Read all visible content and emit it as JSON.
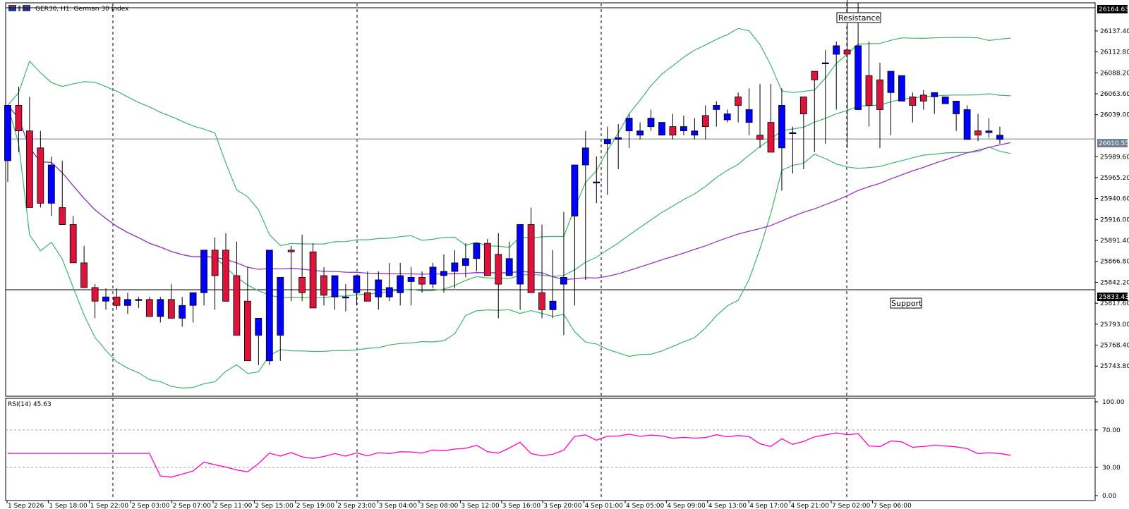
{
  "header": {
    "symbol_label": "GER30, H1:  German 30 Index"
  },
  "price_axis": {
    "ticks": [
      "26137.40",
      "26112.80",
      "26088.20",
      "26063.60",
      "26039.00",
      "25989.60",
      "25965.20",
      "25940.60",
      "25916.00",
      "25891.40",
      "25866.80",
      "25842.20",
      "25817.60",
      "25793.00",
      "25768.40",
      "25743.80"
    ],
    "tick_values": [
      26137.4,
      26112.8,
      26088.2,
      26063.6,
      26039.0,
      25989.6,
      25965.2,
      25940.6,
      25916.0,
      25891.4,
      25866.8,
      25842.2,
      25817.6,
      25793.0,
      25768.4,
      25743.8
    ],
    "resistance_label": "26164.63",
    "current_label": "26010.55",
    "support_label": "25833.43"
  },
  "levels": {
    "resistance": {
      "value": 26164.63,
      "tag": "Resistance"
    },
    "support": {
      "value": 25833.43,
      "tag": "Support"
    },
    "current": 26010.55
  },
  "rsi": {
    "label": "RSI(14) 45.63",
    "ticks": [
      "100.00",
      "70.00",
      "30.00",
      "0.00"
    ],
    "tick_values": [
      100,
      70,
      30,
      0
    ]
  },
  "time_axis": {
    "labels": [
      "1 Sep 2026",
      "1 Sep 18:00",
      "1 Sep 22:00",
      "2 Sep 03:00",
      "2 Sep 07:00",
      "2 Sep 11:00",
      "2 Sep 15:00",
      "2 Sep 19:00",
      "2 Sep 23:00",
      "3 Sep 04:00",
      "3 Sep 08:00",
      "3 Sep 12:00",
      "3 Sep 16:00",
      "3 Sep 20:00",
      "4 Sep 01:00",
      "4 Sep 05:00",
      "4 Sep 09:00",
      "4 Sep 13:00",
      "4 Sep 17:00",
      "4 Sep 21:00",
      "7 Sep 02:00",
      "7 Sep 06:00"
    ]
  },
  "colors": {
    "bull": "#0000ff",
    "bear": "#dc143c",
    "bands": "#3cb371",
    "ma": "#9932cc",
    "rsi": "#ff00c8"
  },
  "chart_data": {
    "type": "candlestick",
    "open": [
      25985,
      26050,
      26020,
      26000,
      25935,
      25930,
      25910,
      25865,
      25836,
      25820,
      25825,
      25815,
      25822,
      25822,
      25802,
      25822,
      25800,
      25815,
      25830,
      25880,
      25880,
      25850,
      25820,
      25780,
      25750,
      25780,
      25880,
      25848,
      25878,
      25850,
      25825,
      25825,
      25830,
      25830,
      25825,
      25825,
      25830,
      25843,
      25848,
      25840,
      25850,
      25855,
      25862,
      25870,
      25888,
      25875,
      25850,
      25840,
      25910,
      25830,
      25810,
      25840,
      25920,
      25980,
      25960,
      26005,
      26010,
      26020,
      26015,
      26025,
      26015,
      26025,
      26020,
      26015,
      26038,
      26045,
      26033,
      26060,
      26030,
      26015,
      26030,
      26000,
      26018,
      26060,
      26090,
      26100,
      26110,
      26115,
      26045,
      26085,
      26080,
      26065,
      26055,
      26060,
      26062,
      26060,
      26052,
      26040,
      26010,
      26020,
      26018,
      26010
    ],
    "high": [
      26000,
      26072,
      26060,
      26020,
      25990,
      25985,
      25920,
      25885,
      25840,
      25835,
      25835,
      25830,
      25825,
      25825,
      25825,
      25840,
      25825,
      25830,
      25850,
      25895,
      25900,
      25890,
      25860,
      25800,
      25810,
      25800,
      25885,
      25898,
      25888,
      25860,
      25845,
      25840,
      25840,
      25855,
      25855,
      25865,
      25865,
      25860,
      25855,
      25865,
      25875,
      25880,
      25888,
      25880,
      25893,
      25900,
      25890,
      25895,
      25930,
      25910,
      25880,
      25925,
      25960,
      26020,
      25990,
      26025,
      26028,
      26040,
      26030,
      26045,
      26030,
      26040,
      26038,
      26035,
      26050,
      26055,
      26045,
      26065,
      26070,
      26075,
      26075,
      26070,
      26025,
      26055,
      26090,
      26115,
      26125,
      26185,
      26170,
      26125,
      26100,
      26090,
      26085,
      26065,
      26068,
      26062,
      26060,
      26055,
      26050,
      26040,
      26035,
      26025
    ],
    "low": [
      25960,
      25995,
      25975,
      25930,
      25920,
      25910,
      25895,
      25850,
      25800,
      25810,
      25810,
      25805,
      25812,
      25808,
      25795,
      25800,
      25790,
      25795,
      25815,
      25810,
      25825,
      25810,
      25775,
      25745,
      25745,
      25750,
      25820,
      25820,
      25832,
      25815,
      25810,
      25808,
      25815,
      25820,
      25810,
      25820,
      25815,
      25815,
      25830,
      25835,
      25830,
      25835,
      25848,
      25855,
      25860,
      25800,
      25850,
      25810,
      25880,
      25800,
      25800,
      25780,
      25815,
      25845,
      25935,
      25945,
      25975,
      26000,
      26010,
      26020,
      26015,
      26010,
      26015,
      26010,
      26010,
      26025,
      26030,
      26030,
      26015,
      26000,
      25995,
      25950,
      25970,
      25975,
      25995,
      26005,
      26045,
      26000,
      26060,
      26025,
      26000,
      26015,
      26055,
      26030,
      26045,
      26040,
      26055,
      26020,
      26010,
      26008,
      26012,
      26005
    ],
    "close": [
      26050,
      26020,
      25930,
      25935,
      25980,
      25910,
      25865,
      25836,
      25820,
      25825,
      25815,
      25822,
      25822,
      25802,
      25822,
      25800,
      25815,
      25830,
      25880,
      25850,
      25820,
      25780,
      25750,
      25800,
      25880,
      25848,
      25878,
      25830,
      25812,
      25827,
      25850,
      25825,
      25850,
      25820,
      25845,
      25836,
      25850,
      25848,
      25840,
      25860,
      25855,
      25865,
      25870,
      25888,
      25850,
      25840,
      25870,
      25910,
      25830,
      25810,
      25820,
      25848,
      25980,
      26000,
      25960,
      26010,
      26012,
      26035,
      26020,
      26035,
      26030,
      26015,
      26025,
      26020,
      26025,
      26050,
      26040,
      26050,
      26045,
      26010,
      25995,
      26050,
      26018,
      26040,
      26080,
      26100,
      26120,
      26110,
      26120,
      26050,
      26045,
      26090,
      26085,
      26050,
      26055,
      26065,
      26060,
      26055,
      26045,
      26015,
      26020,
      26015,
      26005
    ]
  }
}
